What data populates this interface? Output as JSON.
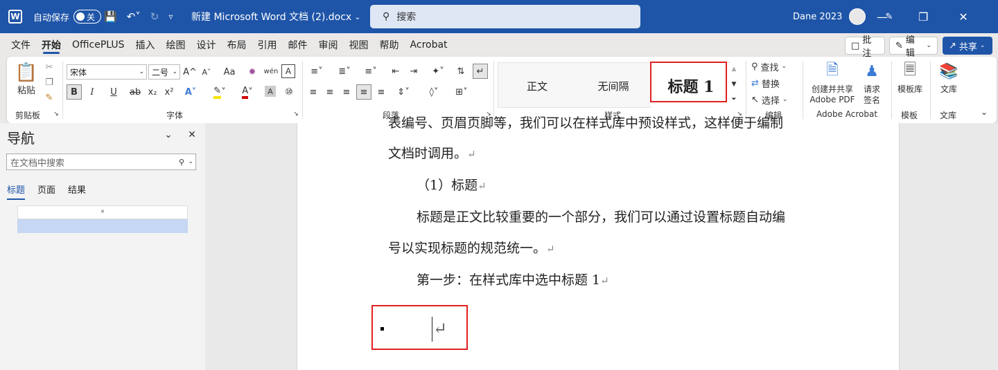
{
  "titlebar": {
    "autosave_label": "自动保存",
    "autosave_state": "关",
    "doc_title": "新建 Microsoft Word 文档 (2).docx",
    "search_placeholder": "搜索",
    "user_name": "Dane 2023"
  },
  "menu": {
    "tabs": [
      "文件",
      "开始",
      "OfficePLUS",
      "插入",
      "绘图",
      "设计",
      "布局",
      "引用",
      "邮件",
      "审阅",
      "视图",
      "帮助",
      "Acrobat"
    ],
    "active_tab": "开始",
    "comment_button": "批注",
    "edit_button": "编辑",
    "share_button": "共享"
  },
  "ribbon": {
    "clipboard": {
      "paste": "粘贴",
      "label": "剪贴板"
    },
    "font": {
      "name": "宋体",
      "size": "二号",
      "label": "字体",
      "bold": "B",
      "italic": "I",
      "underline": "U",
      "strike": "ab",
      "sub": "x₂",
      "sup": "x²",
      "grow": "A^",
      "shrink": "Aˇ",
      "case": "Aa",
      "phonetic": "wén",
      "border_char": "A"
    },
    "paragraph": {
      "label": "段落"
    },
    "styles": {
      "label": "样式",
      "items": [
        "正文",
        "无间隔",
        "标题 1"
      ]
    },
    "editing": {
      "label": "编辑",
      "find": "查找",
      "replace": "替换",
      "select": "选择"
    },
    "acrobat": {
      "label": "Adobe Acrobat",
      "create_line1": "创建并共享",
      "create_line2": "Adobe PDF",
      "sign_line1": "请求",
      "sign_line2": "签名"
    },
    "templates": {
      "label": "模板",
      "button": "模板库"
    },
    "library": {
      "label": "文库",
      "button": "文库"
    }
  },
  "navpane": {
    "title": "导航",
    "search_placeholder": "在文档中搜索",
    "tabs": [
      "标题",
      "页面",
      "结果"
    ],
    "active_tab": "标题"
  },
  "document": {
    "line0": "表编号、页眉页脚等，我们可以在样式库中预设样式，这样便于编制",
    "line1": "文档时调用。",
    "line2": "（1）标题",
    "line3": "标题是正文比较重要的一个部分，我们可以通过设置标题自动编",
    "line4": "号以实现标题的规范统一。",
    "line5": "第一步：在样式库中选中标题 1",
    "para_mark": "↵"
  },
  "colors": {
    "brand": "#1f55a8",
    "highlight": "#e02020"
  }
}
